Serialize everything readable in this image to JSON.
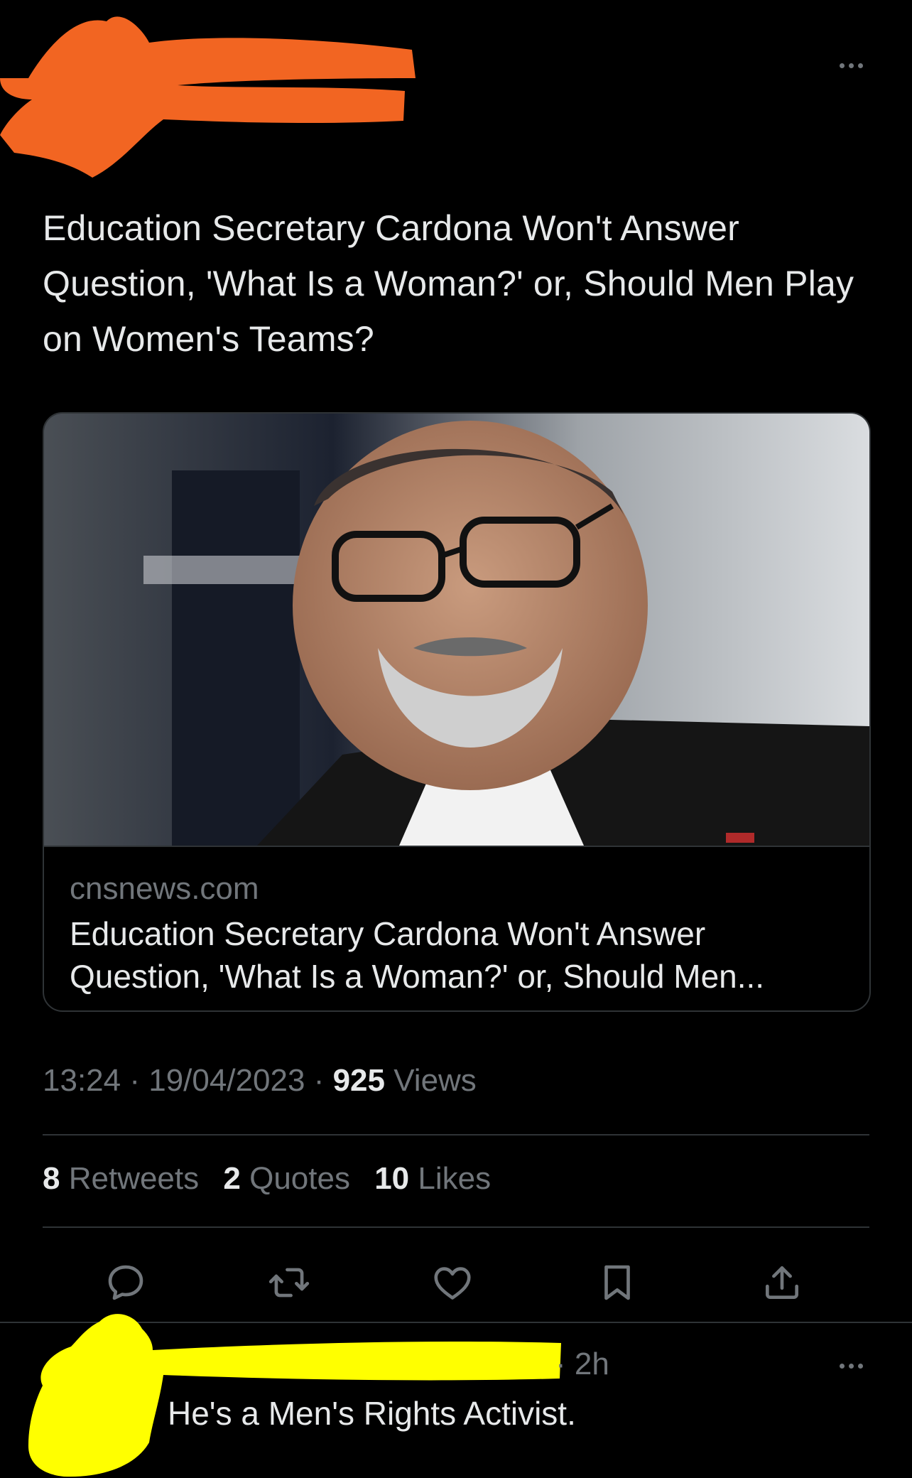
{
  "tweet": {
    "text": "Education Secretary Cardona Won't Answer Question, 'What Is a Woman?' or, Should Men Play on Women's Teams?"
  },
  "card": {
    "domain": "cnsnews.com",
    "title": "Education Secretary Cardona Won't Answer Question, 'What Is a Woman?' or, Should Men..."
  },
  "meta": {
    "time": "13:24",
    "separator": "·",
    "date": "19/04/2023",
    "views_count": "925",
    "views_label": "Views"
  },
  "stats": {
    "retweets_count": "8",
    "retweets_label": "Retweets",
    "quotes_count": "2",
    "quotes_label": "Quotes",
    "likes_count": "10",
    "likes_label": "Likes"
  },
  "actions": [
    "reply-icon",
    "retweet-icon",
    "like-icon",
    "bookmark-icon",
    "share-icon"
  ],
  "reply": {
    "time": "· 2h",
    "text": "He's a Men's Rights Activist."
  },
  "colors": {
    "background": "#000000",
    "text": "#e7e9ea",
    "secondary_text": "#71767b",
    "divider": "#2f3336",
    "redaction_orange": "#f26522",
    "redaction_yellow": "#ffff00"
  }
}
